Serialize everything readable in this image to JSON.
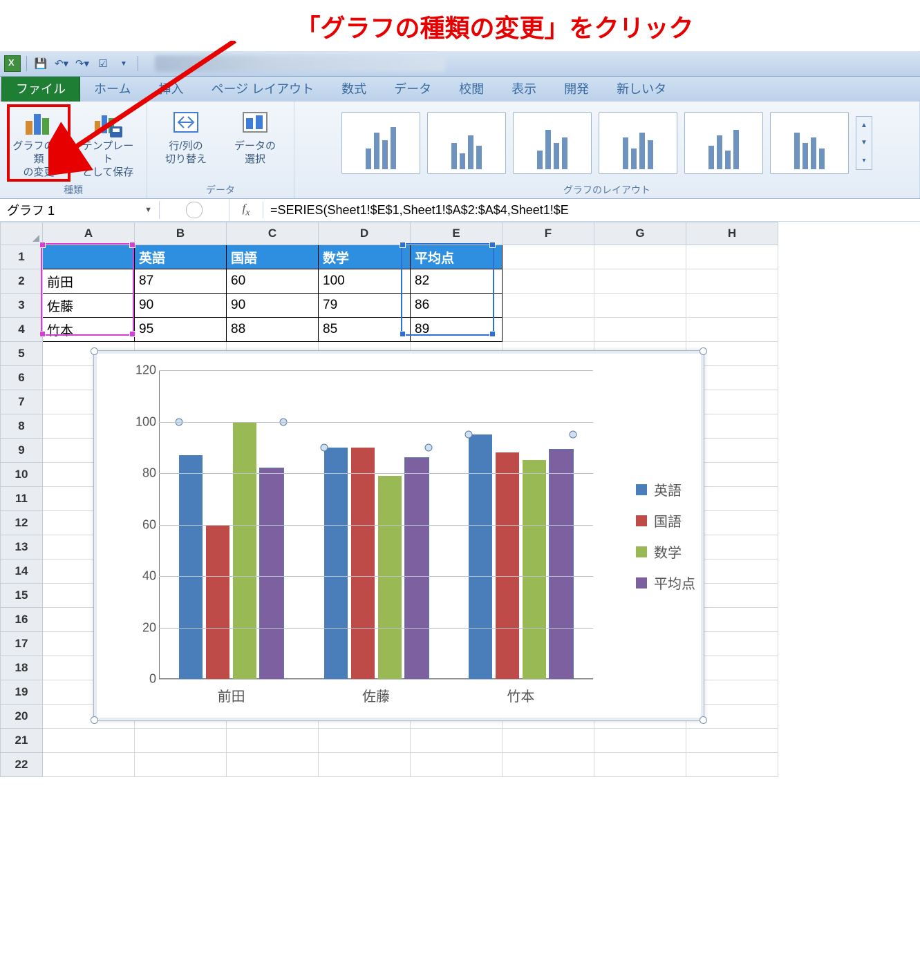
{
  "annotation": "「グラフの種類の変更」をクリック",
  "qat": {
    "save_tip": "上書き保存",
    "undo_tip": "元に戻す",
    "redo_tip": "やり直し"
  },
  "tabs": {
    "file": "ファイル",
    "home": "ホーム",
    "insert": "挿入",
    "layout": "ページ レイアウト",
    "formulas": "数式",
    "data": "データ",
    "review": "校閲",
    "view": "表示",
    "dev": "開発",
    "new": "新しいタ"
  },
  "ribbon": {
    "change_type": "グラフの種類\nの変更",
    "save_template": "テンプレート\nとして保存",
    "switch_rowcol": "行/列の\n切り替え",
    "select_data": "データの\n選択",
    "group_type": "種類",
    "group_data": "データ",
    "group_layout": "グラフのレイアウト"
  },
  "namebox": "グラフ 1",
  "formula": "=SERIES(Sheet1!$E$1,Sheet1!$A$2:$A$4,Sheet1!$E",
  "columns": [
    "A",
    "B",
    "C",
    "D",
    "E",
    "F",
    "G",
    "H"
  ],
  "rows": [
    "1",
    "2",
    "3",
    "4",
    "5",
    "6",
    "7",
    "8",
    "9",
    "10",
    "11",
    "12",
    "13",
    "14",
    "15",
    "16",
    "17",
    "18",
    "19",
    "20",
    "21",
    "22"
  ],
  "table": {
    "headers": [
      "",
      "英語",
      "国語",
      "数学",
      "平均点"
    ],
    "data": [
      [
        "前田",
        "87",
        "60",
        "100",
        "82"
      ],
      [
        "佐藤",
        "90",
        "90",
        "79",
        "86"
      ],
      [
        "竹本",
        "95",
        "88",
        "85",
        "89"
      ]
    ]
  },
  "chart_data": {
    "type": "bar",
    "categories": [
      "前田",
      "佐藤",
      "竹本"
    ],
    "series": [
      {
        "name": "英語",
        "values": [
          87,
          90,
          95
        ],
        "color": "#4a7ebb"
      },
      {
        "name": "国語",
        "values": [
          60,
          90,
          88
        ],
        "color": "#be4b48"
      },
      {
        "name": "数学",
        "values": [
          100,
          79,
          85
        ],
        "color": "#98b954"
      },
      {
        "name": "平均点",
        "values": [
          82,
          86,
          89
        ],
        "color": "#7d60a0"
      }
    ],
    "ylim": [
      0,
      120
    ],
    "yticks": [
      0,
      20,
      40,
      60,
      80,
      100,
      120
    ],
    "selected_series": "平均点",
    "title": "",
    "xlabel": "",
    "ylabel": ""
  }
}
